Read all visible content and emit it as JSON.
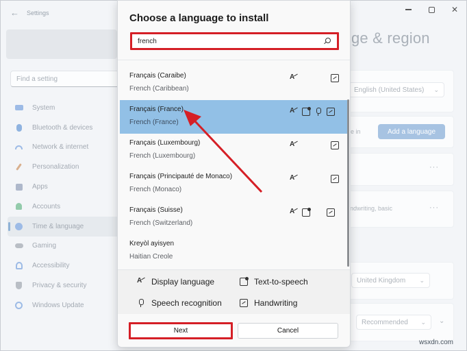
{
  "settings": {
    "app_title": "Settings",
    "find_placeholder": "Find a setting",
    "nav": [
      {
        "label": "System",
        "icon": "monitor-icon",
        "color": "#5b8fd6"
      },
      {
        "label": "Bluetooth & devices",
        "icon": "bluetooth-icon",
        "color": "#3f7fcf"
      },
      {
        "label": "Network & internet",
        "icon": "wifi-icon",
        "color": "#4a8ad6"
      },
      {
        "label": "Personalization",
        "icon": "brush-icon",
        "color": "#c98a55"
      },
      {
        "label": "Apps",
        "icon": "apps-icon",
        "color": "#6f7fa0"
      },
      {
        "label": "Accounts",
        "icon": "person-icon",
        "color": "#3fa36a"
      },
      {
        "label": "Time & language",
        "icon": "globe-clock-icon",
        "color": "#3f86cf"
      },
      {
        "label": "Gaming",
        "icon": "controller-icon",
        "color": "#8a8f98"
      },
      {
        "label": "Accessibility",
        "icon": "accessibility-icon",
        "color": "#3f86cf"
      },
      {
        "label": "Privacy & security",
        "icon": "shield-icon",
        "color": "#8a8f98"
      },
      {
        "label": "Windows Update",
        "icon": "update-icon",
        "color": "#3f86cf"
      }
    ],
    "heading": "ge & region",
    "display_language_value": "English (United States)",
    "add_language_label": "Add a language",
    "partial_text_ge_in": "ge in",
    "partial_text_handwriting": "ndwriting, basic",
    "region_value": "United Kingdom",
    "format_value": "Recommended"
  },
  "dialog": {
    "title": "Choose a language to install",
    "search_value": "french",
    "languages": [
      {
        "name": "Français (Caraibe)",
        "sub": "French (Caribbean)",
        "features": [
          "display",
          "hand"
        ],
        "selected": false
      },
      {
        "name": "Français (France)",
        "sub": "French (France)",
        "features": [
          "display",
          "tts",
          "speech",
          "hand"
        ],
        "selected": true
      },
      {
        "name": "Français (Luxembourg)",
        "sub": "French (Luxembourg)",
        "features": [
          "display",
          "hand"
        ],
        "selected": false
      },
      {
        "name": "Français (Principauté de Monaco)",
        "sub": "French (Monaco)",
        "features": [
          "display",
          "hand"
        ],
        "selected": false
      },
      {
        "name": "Français (Suisse)",
        "sub": "French (Switzerland)",
        "features": [
          "display",
          "tts",
          "hand"
        ],
        "selected": false
      },
      {
        "name": "Kreyòl ayisyen",
        "sub": "Haitian Creole",
        "features": [],
        "selected": false
      }
    ],
    "legend": {
      "display": "Display language",
      "tts": "Text-to-speech",
      "speech": "Speech recognition",
      "hand": "Handwriting"
    },
    "next_label": "Next",
    "cancel_label": "Cancel"
  },
  "colors": {
    "annotation_red": "#d51f26",
    "selection_blue": "#92c0e6",
    "accent_button": "#a7c3e2"
  },
  "watermark": "wsxdn.com"
}
